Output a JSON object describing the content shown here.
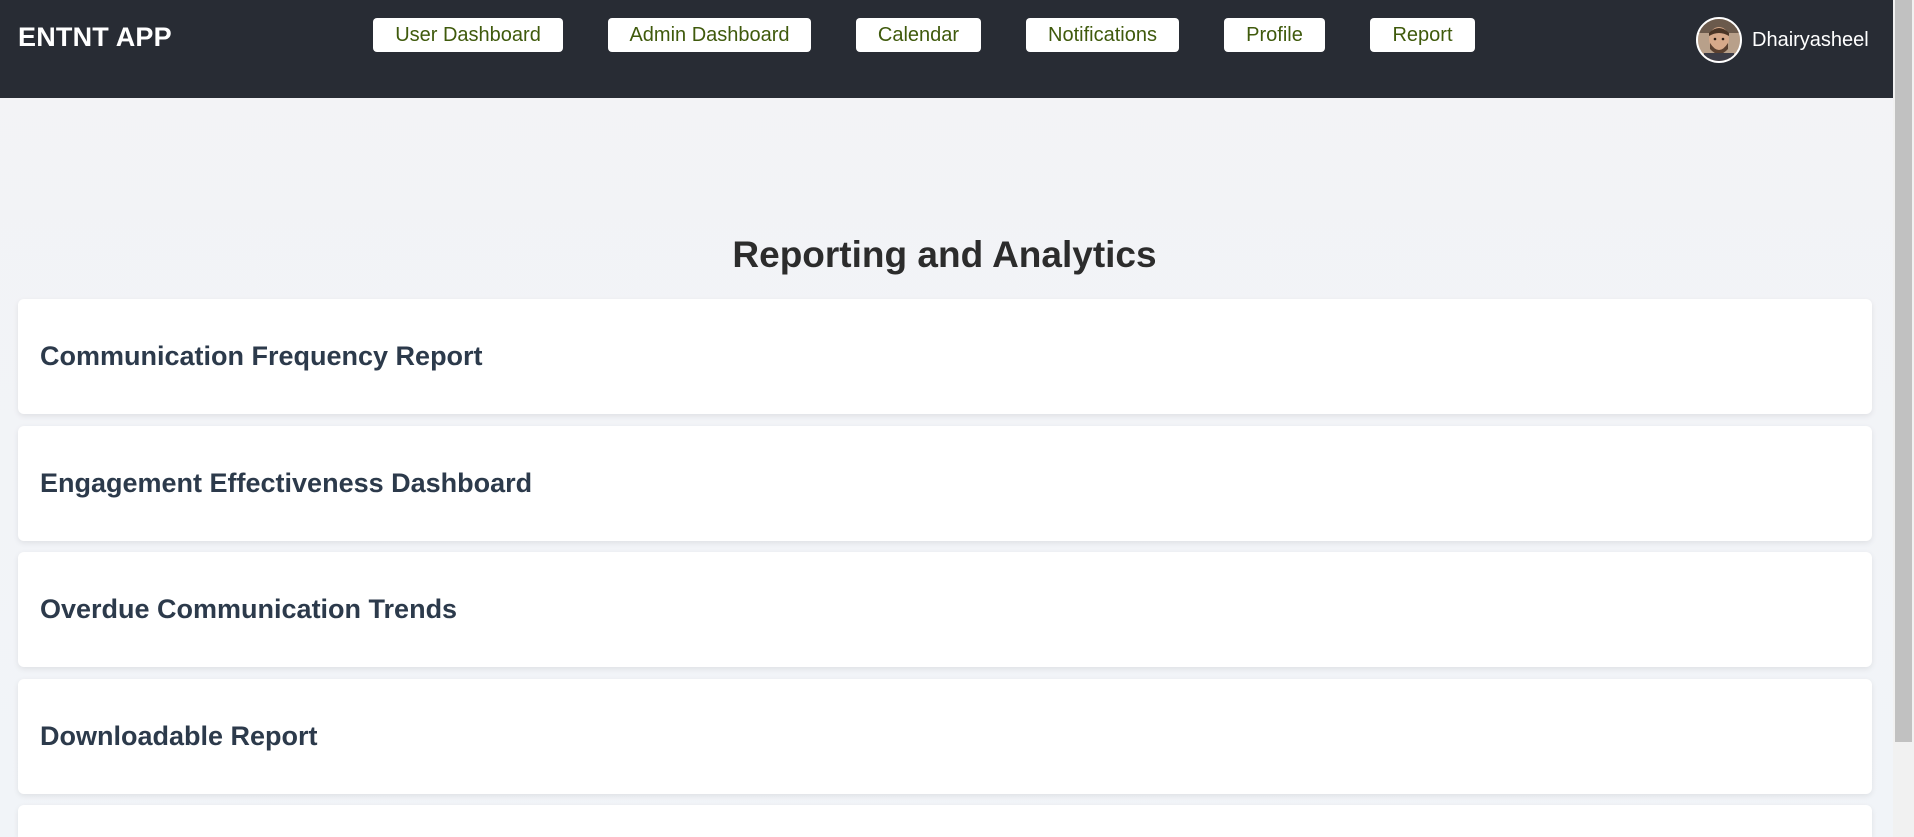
{
  "app": {
    "brand": "ENTNT APP"
  },
  "nav": {
    "items": [
      {
        "label": "User Dashboard"
      },
      {
        "label": "Admin Dashboard"
      },
      {
        "label": "Calendar"
      },
      {
        "label": "Notifications"
      },
      {
        "label": "Profile"
      },
      {
        "label": "Report"
      }
    ]
  },
  "user": {
    "name": "Dhairyasheel",
    "avatar_icon": "user-avatar"
  },
  "main": {
    "title": "Reporting and Analytics",
    "reports": [
      {
        "title": "Communication Frequency Report"
      },
      {
        "title": "Engagement Effectiveness Dashboard"
      },
      {
        "title": "Overdue Communication Trends"
      },
      {
        "title": "Downloadable Report"
      },
      {
        "title": ""
      }
    ]
  },
  "colors": {
    "header_bg": "#282c34",
    "nav_text": "#3f5a0c",
    "card_title": "#2c3a4b",
    "page_bg": "#f2f4f7"
  }
}
